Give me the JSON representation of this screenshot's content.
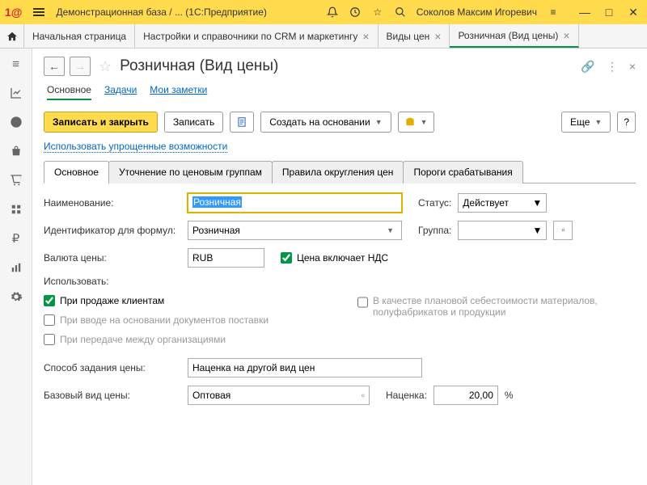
{
  "titlebar": {
    "title": "Демонстрационная база / ...   (1С:Предприятие)",
    "user": "Соколов Максим Игоревич"
  },
  "tabs": {
    "start": "Начальная страница",
    "crm": "Настройки и справочники по CRM и маркетингу",
    "pricetypes": "Виды цен",
    "retail": "Розничная (Вид цены)"
  },
  "page": {
    "title": "Розничная (Вид цены)"
  },
  "subnav": {
    "main": "Основное",
    "tasks": "Задачи",
    "notes": "Мои заметки"
  },
  "toolbar": {
    "save_close": "Записать и закрыть",
    "save": "Записать",
    "create_based": "Создать на основании",
    "more": "Еще",
    "help": "?"
  },
  "simplified_link": "Использовать упрощенные возможности",
  "inner_tabs": {
    "main": "Основное",
    "refine": "Уточнение по ценовым группам",
    "rounding": "Правила округления цен",
    "thresholds": "Пороги срабатывания"
  },
  "form": {
    "name_label": "Наименование:",
    "name_value": "Розничная",
    "status_label": "Статус:",
    "status_value": "Действует",
    "id_label": "Идентификатор для формул:",
    "id_value": "Розничная",
    "group_label": "Группа:",
    "group_value": "",
    "currency_label": "Валюта цены:",
    "currency_value": "RUB",
    "vat_label": "Цена включает НДС",
    "use_label": "Использовать:",
    "chk_sale": "При продаже клиентам",
    "chk_plan": "В качестве плановой себестоимости материалов, полуфабрикатов и продукции",
    "chk_supply": "При вводе на основании документов поставки",
    "chk_transfer": "При передаче между организациями",
    "method_label": "Способ задания цены:",
    "method_value": "Наценка на другой вид цен",
    "base_label": "Базовый вид цены:",
    "base_value": "Оптовая",
    "markup_label": "Наценка:",
    "markup_value": "20,00",
    "markup_unit": "%"
  }
}
